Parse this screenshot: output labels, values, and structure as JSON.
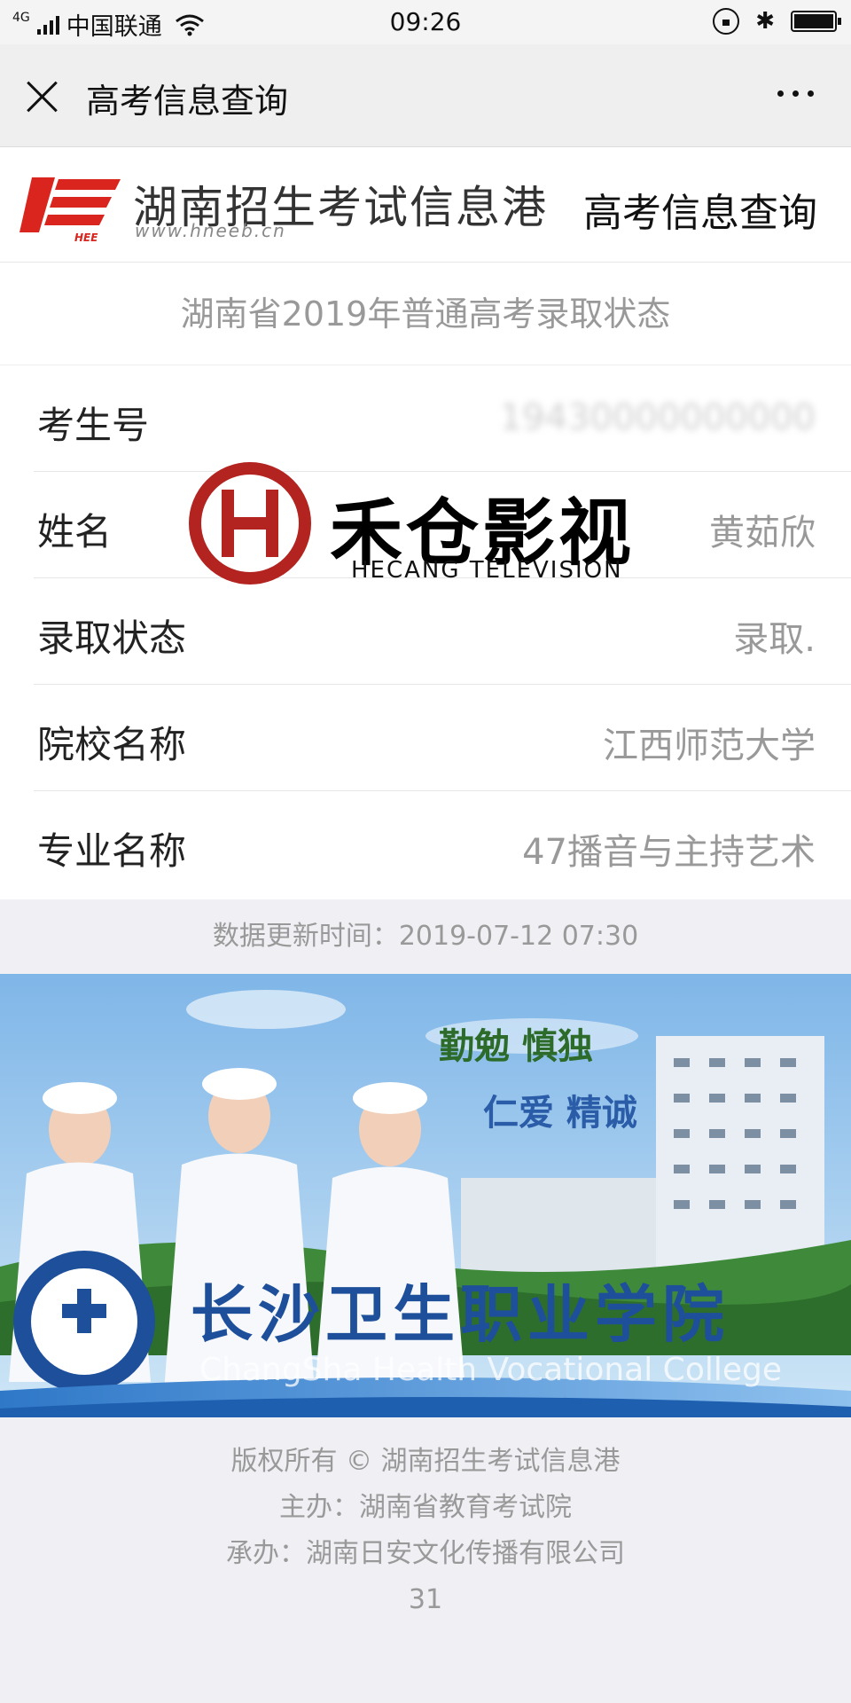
{
  "status_bar": {
    "network_type": "4G",
    "carrier": "中国联通",
    "time": "09:26",
    "icons": [
      "signal-icon",
      "wifi-icon",
      "rotation-lock-icon",
      "bluetooth-icon",
      "battery-icon"
    ]
  },
  "nav": {
    "title": "高考信息查询",
    "close_icon": "close-icon",
    "more_icon": "more-icon"
  },
  "header": {
    "site_name": "湖南招生考试信息港",
    "site_url": "www.hneeb.cn",
    "logo_text": "HEE",
    "right_title": "高考信息查询"
  },
  "result": {
    "section_title": "湖南省2019年普通高考录取状态",
    "rows": [
      {
        "label": "考生号",
        "value": "19430000000000"
      },
      {
        "label": "姓名",
        "value": "黄茹欣"
      },
      {
        "label": "录取状态",
        "value": "录取."
      },
      {
        "label": "院校名称",
        "value": "江西师范大学"
      },
      {
        "label": "专业名称",
        "value": "47播音与主持艺术"
      }
    ],
    "update_time": "数据更新时间：2019-07-12 07:30"
  },
  "watermark": {
    "cn": "禾仓影视",
    "en": "HECANG TELEVISION"
  },
  "banner": {
    "slogan_1": "勤勉 慎独",
    "slogan_2": "仁爱 精诚",
    "college_name": "长沙卫生职业学院",
    "college_name_en": "ChangSha Health Vocational College"
  },
  "footer": {
    "copyright": "版权所有 © 湖南招生考试信息港",
    "sponsor": "主办：湖南省教育考试院",
    "organizer": "承办：湖南日安文化传播有限公司",
    "counter": "31"
  },
  "colors": {
    "brand_red": "#d9251d",
    "background": "#efeff4",
    "label_gray": "#999999",
    "watermark_red": "#b3231f"
  }
}
